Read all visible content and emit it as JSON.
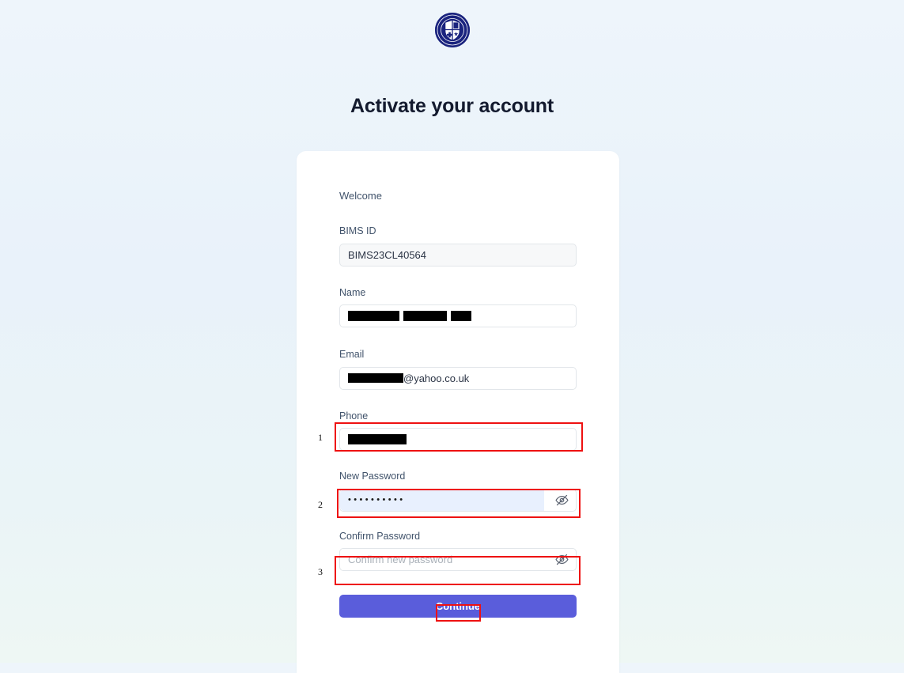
{
  "page": {
    "title": "Activate your account",
    "background_color": "#eaf2fa"
  },
  "logo": {
    "name": "university-seal-logo",
    "color": "#1a237e"
  },
  "form": {
    "welcome_text": "Welcome",
    "fields": {
      "bims_id": {
        "label": "BIMS ID",
        "value": "BIMS23CL40564",
        "disabled": true
      },
      "name": {
        "label": "Name",
        "value": "",
        "redacted": true
      },
      "email": {
        "label": "Email",
        "value_suffix": "@yahoo.co.uk",
        "redacted": true
      },
      "phone": {
        "label": "Phone",
        "value": "",
        "redacted": true
      },
      "new_password": {
        "label": "New Password",
        "value": "••••••••••",
        "toggle_icon": "eye-off-icon"
      },
      "confirm_password": {
        "label": "Confirm Password",
        "value": "",
        "placeholder": "Confirm new password",
        "toggle_icon": "eye-off-icon"
      }
    },
    "submit": {
      "label": "Continue",
      "color": "#5a5ddb"
    }
  },
  "annotations": {
    "color": "#ee1111",
    "markers": [
      {
        "number": "1",
        "target": "phone-field"
      },
      {
        "number": "2",
        "target": "new-password-field"
      },
      {
        "number": "3",
        "target": "confirm-password-field"
      },
      {
        "number": "",
        "target": "continue-button-label"
      }
    ]
  }
}
